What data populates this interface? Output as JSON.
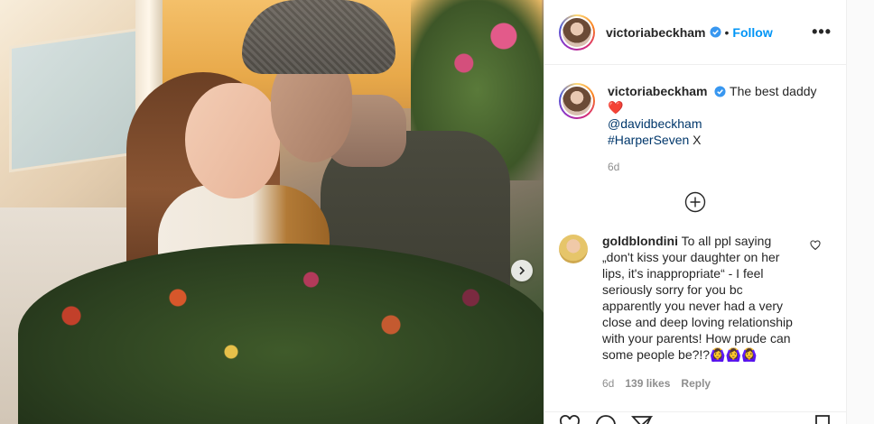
{
  "post": {
    "username": "victoriabeckham",
    "separator": "•",
    "follow_label": "Follow",
    "more_label": "•••",
    "caption_text": "The best daddy",
    "caption_emoji": "❤️",
    "caption_mention": "@davidbeckham",
    "caption_hashtag": "#HarperSeven",
    "caption_suffix": " X",
    "time_ago": "6d"
  },
  "comments": [
    {
      "username": "goldblondini",
      "text": "To all ppl saying „don't kiss your daughter on her lips, it's inappropriate“ - I feel seriously sorry for you bc apparently you never had a very close and deep loving relationship with your parents! How prude can some people be?!?",
      "emoji": "🙆‍♀️🙆‍♀️🙆‍♀️",
      "time_ago": "6d",
      "likes": "139 likes",
      "reply_label": "Reply"
    }
  ],
  "icons": {
    "verified": "verified-badge-icon",
    "more": "more-options-icon",
    "load_more": "plus-circle-icon",
    "like": "heart-icon",
    "comment": "comment-icon",
    "share": "share-icon",
    "save": "bookmark-icon",
    "next": "chevron-right-icon"
  },
  "colors": {
    "follow": "#0095f6",
    "link": "#00376b",
    "verified": "#3897f0",
    "muted": "#8e8e8e",
    "heart": "#ed4956"
  }
}
